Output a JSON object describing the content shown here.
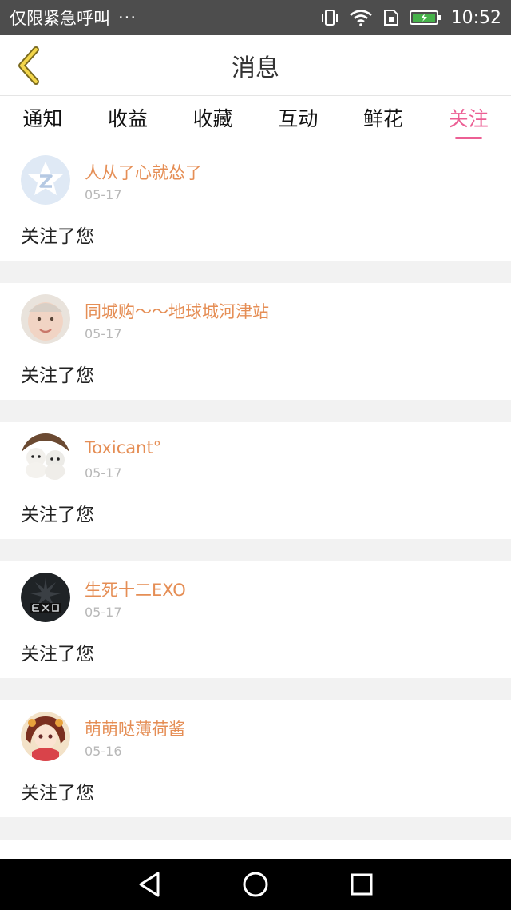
{
  "status_bar": {
    "carrier": "仅限紧急呼叫",
    "more": "···",
    "time": "10:52",
    "icons": [
      "vibrate-icon",
      "wifi-icon",
      "sim-icon",
      "battery-charging-icon"
    ]
  },
  "header": {
    "back_icon": "chevron-left-icon",
    "title": "消息"
  },
  "tabs": [
    {
      "label": "通知",
      "active": false
    },
    {
      "label": "收益",
      "active": false
    },
    {
      "label": "收藏",
      "active": false
    },
    {
      "label": "互动",
      "active": false
    },
    {
      "label": "鲜花",
      "active": false
    },
    {
      "label": "关注",
      "active": true
    }
  ],
  "notifications": [
    {
      "name": "人从了心就怂了",
      "date": "05-17",
      "message": "关注了您",
      "avatar": "default-star-avatar"
    },
    {
      "name": "同城购～～地球城河津站",
      "date": "05-17",
      "message": "关注了您",
      "avatar": "baby-photo-avatar"
    },
    {
      "name": "Toxicant°",
      "date": "05-17",
      "message": "关注了您",
      "avatar": "white-dogs-avatar"
    },
    {
      "name": "生死十二EXO",
      "date": "05-17",
      "message": "关注了您",
      "avatar": "dark-exo-avatar"
    },
    {
      "name": "萌萌哒薄荷酱",
      "date": "05-16",
      "message": "关注了您",
      "avatar": "anime-girl-avatar"
    }
  ],
  "colors": {
    "accent": "#ec5f94",
    "username": "#e58e55",
    "status_bar": "#4d4d4d",
    "nav_bar": "#000000"
  },
  "nav_bar": {
    "icons": [
      "back-triangle-icon",
      "home-circle-icon",
      "recents-square-icon"
    ]
  }
}
